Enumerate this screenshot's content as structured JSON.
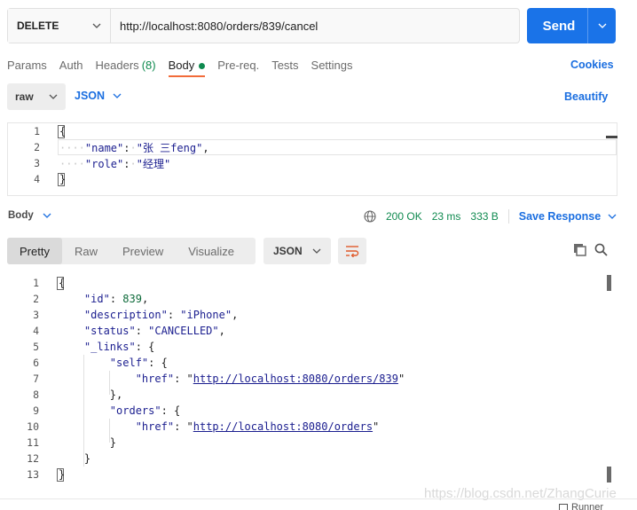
{
  "request": {
    "method": "DELETE",
    "url": "http://localhost:8080/orders/839/cancel",
    "send_label": "Send"
  },
  "request_tabs": [
    {
      "label": "Params"
    },
    {
      "label": "Auth"
    },
    {
      "label": "Headers",
      "count": "(8)"
    },
    {
      "label": "Body",
      "active": true
    },
    {
      "label": "Pre-req."
    },
    {
      "label": "Tests"
    },
    {
      "label": "Settings"
    }
  ],
  "cookies_label": "Cookies",
  "body_mode": {
    "type": "raw",
    "format": "JSON",
    "beautify": "Beautify"
  },
  "request_body": {
    "line_numbers": [
      "1",
      "2",
      "3",
      "4"
    ],
    "open": "{",
    "close": "}",
    "indent": "····",
    "name_key": "\"name\"",
    "name_value": "\"张 三feng\"",
    "role_key": "\"role\"",
    "role_value": "\"经理\""
  },
  "response": {
    "section_label": "Body",
    "status": "200 OK",
    "time": "23 ms",
    "size": "333 B",
    "save_label": "Save Response",
    "tabs": [
      "Pretty",
      "Raw",
      "Preview",
      "Visualize"
    ],
    "format": "JSON",
    "line_numbers": [
      "1",
      "2",
      "3",
      "4",
      "5",
      "6",
      "7",
      "8",
      "9",
      "10",
      "11",
      "12",
      "13"
    ],
    "json": {
      "id_key": "\"id\"",
      "id_value": "839",
      "description_key": "\"description\"",
      "description_value": "\"iPhone\"",
      "status_key": "\"status\"",
      "status_value": "\"CANCELLED\"",
      "links_key": "\"_links\"",
      "self_key": "\"self\"",
      "href_key": "\"href\"",
      "self_href": "http://localhost:8080/orders/839",
      "orders_key": "\"orders\"",
      "orders_href": "http://localhost:8080/orders"
    }
  },
  "watermark": "https://blog.csdn.net/ZhangCurie",
  "runner_label": "Runner",
  "colors": {
    "accent": "#1a73e8",
    "active_tab": "#f26b3a",
    "success": "#0f8a4f"
  }
}
